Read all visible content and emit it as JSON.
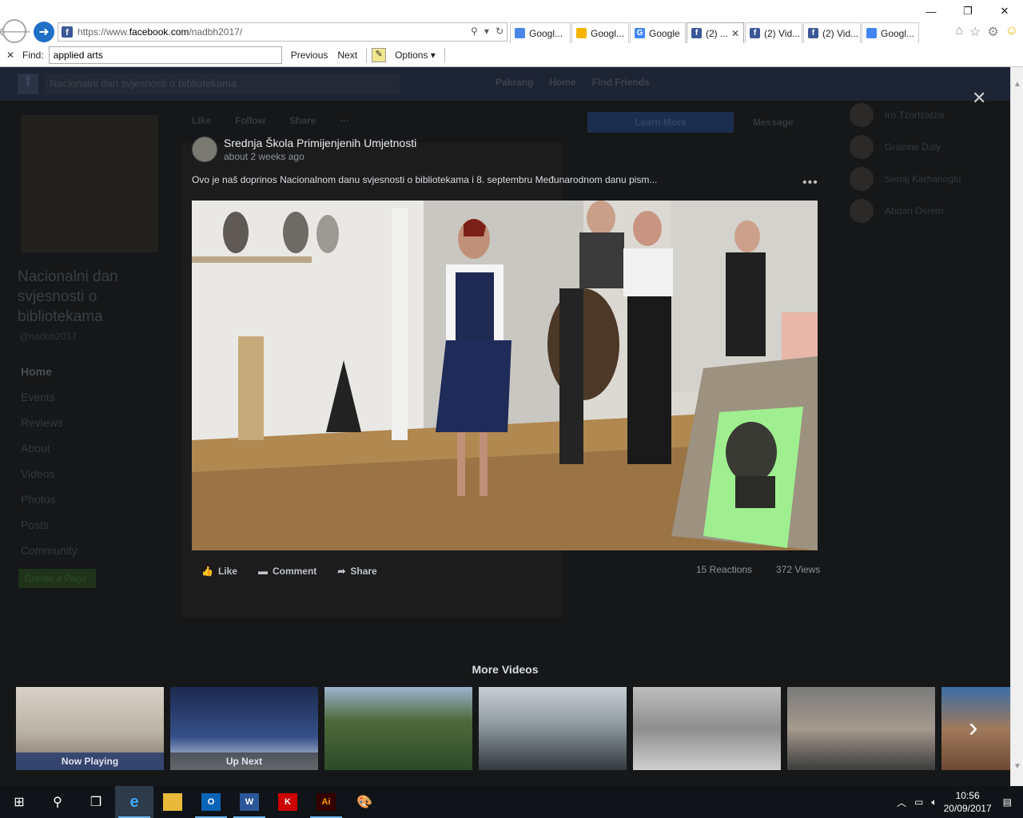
{
  "browser": {
    "url_prefix": "https://www.",
    "url_domain": "facebook.com",
    "url_path": "/nadbh2017/",
    "tabs": [
      {
        "label": "Googl...",
        "icon": "google-docs-icon",
        "color": "#4a86e8"
      },
      {
        "label": "Googl...",
        "icon": "google-drive-icon",
        "color": "#f4b400"
      },
      {
        "label": "Google",
        "icon": "google-icon",
        "color": "#4285f4"
      },
      {
        "label": "(2) ...",
        "icon": "facebook-icon",
        "color": "#3b5998",
        "close": "✕"
      },
      {
        "label": "(2) Vid...",
        "icon": "facebook-icon",
        "color": "#3b5998"
      },
      {
        "label": "(2) Vid...",
        "icon": "facebook-icon",
        "color": "#3b5998"
      },
      {
        "label": "Googl...",
        "icon": "google-translate-icon",
        "color": "#4285f4"
      }
    ],
    "find": {
      "label": "Find:",
      "value": "applied arts",
      "previous": "Previous",
      "next": "Next",
      "options": "Options"
    }
  },
  "facebook": {
    "search_value": "Nacionalni dan svjesnosti o bibliotekama",
    "nav": [
      "Pakrang",
      "Home",
      "Find Friends"
    ],
    "page_title": "Nacionalni dan svjesnosti o bibliotekama",
    "page_handle": "@nadbh2017",
    "left_nav": [
      "Home",
      "Events",
      "Reviews",
      "About",
      "Videos",
      "Photos",
      "Posts",
      "Community"
    ],
    "create_page": "Create a Page",
    "post_actions": [
      "Like",
      "Follow",
      "Share",
      "···"
    ],
    "learn_more": "Learn More",
    "message": "Message",
    "chat": [
      "Iro Tzortzatzis",
      "Gráinne Daly",
      "Senaj Karhanoglu",
      "Abdan Osrein"
    ]
  },
  "viewer": {
    "poster_name": "Srednja Škola Primijenjenih Umjetnosti",
    "poster_time": "about 2 weeks ago",
    "caption": "Ovo je naš doprinos Nacionalnom danu svjesnosti o bibliotekama i 8. septembru Međunarodnom danu pism...",
    "actions": {
      "like": "Like",
      "comment": "Comment",
      "share": "Share"
    },
    "reactions": "15 Reactions",
    "views": "372 Views",
    "more_videos": "More Videos",
    "thumbs": [
      {
        "label": "Now Playing"
      },
      {
        "label": "Up Next"
      },
      {
        "label": ""
      },
      {
        "label": ""
      },
      {
        "label": ""
      },
      {
        "label": ""
      },
      {
        "label": ""
      }
    ]
  },
  "taskbar": {
    "time": "10:56",
    "date": "20/09/2017"
  }
}
